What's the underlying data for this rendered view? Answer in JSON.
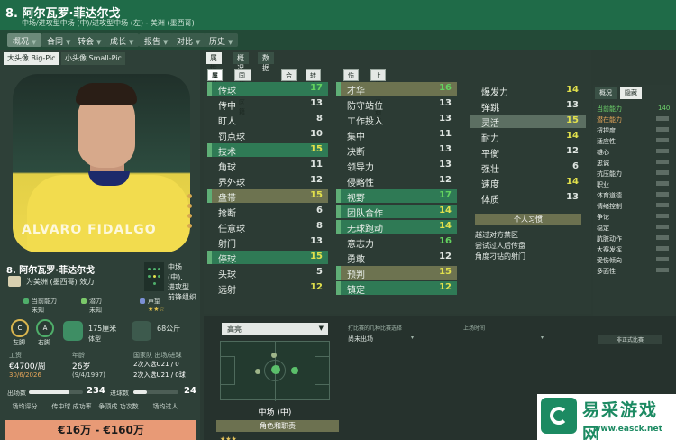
{
  "header": {
    "title": "8. 阿尔瓦罗·菲达尔戈",
    "subtitle": "中场/进攻型中场 (中)/进攻型中场 (左) - 美洲 (墨西哥)"
  },
  "nav_tabs": [
    "概况",
    "合同",
    "转会",
    "成长",
    "报告",
    "对比",
    "历史"
  ],
  "photo_tabs": [
    "大头像 Big-Pic",
    "小头像 Small-Pic"
  ],
  "photo": {
    "watermark": "ALVARO FIDALGO"
  },
  "player": {
    "name": "8. 阿尔瓦罗·菲达尔戈",
    "club_line": "为美洲 (墨西哥) 效力",
    "position_line1": "中场 (中),",
    "position_line2": "进攻型...",
    "position_line3": "前锋组织"
  },
  "info": {
    "current_ability_label": "当前能力",
    "current_ability_value": "未知",
    "potential_label": "潜力",
    "potential_value": "未知",
    "reputation_label": "声望",
    "foot_left_label": "左脚",
    "foot_right_label": "右脚",
    "foot_left_value": "C",
    "foot_right_value": "A",
    "height": "175厘米",
    "height_sub": "体型",
    "weight": "68公斤"
  },
  "contract": {
    "wage_label": "工资",
    "wage_value": "€4700/周",
    "wage_date": "30/6/2026",
    "age_label": "年龄",
    "age_value": "26岁",
    "age_date": "(9/4/1997)",
    "caps_label": "国家队 出场/进球",
    "caps_value": "2次入选U21 / 0",
    "caps_sub": "2次入选U21 / 0球"
  },
  "bars": {
    "left_label": "出场数",
    "left_value": "234",
    "left_fraction": 0.75,
    "right_label": "进球数",
    "right_value": "24",
    "right_fraction": 0.3
  },
  "bottom_headers": [
    "场均评分",
    "传中球 成功率",
    "争顶成 功次数",
    "场均过人"
  ],
  "value_range": "€16万 - €160万",
  "mid_tabs": [
    "属性",
    "概况",
    "数据"
  ],
  "attr_tabs": [
    "属性",
    "国籍/地区籍",
    "合同",
    "转会状态",
    "伤病",
    "上场时间通道"
  ],
  "technical": [
    {
      "name": "传球",
      "value": "17",
      "color": "green",
      "hl": "green"
    },
    {
      "name": "传中",
      "value": "13",
      "color": "white",
      "hl": ""
    },
    {
      "name": "盯人",
      "value": "8",
      "color": "white",
      "hl": ""
    },
    {
      "name": "罚点球",
      "value": "10",
      "color": "white",
      "hl": ""
    },
    {
      "name": "技术",
      "value": "15",
      "color": "yellow",
      "hl": "green"
    },
    {
      "name": "角球",
      "value": "11",
      "color": "white",
      "hl": ""
    },
    {
      "name": "界外球",
      "value": "12",
      "color": "white",
      "hl": ""
    },
    {
      "name": "盘带",
      "value": "15",
      "color": "yellow",
      "hl": "olive"
    },
    {
      "name": "抢断",
      "value": "6",
      "color": "white",
      "hl": ""
    },
    {
      "name": "任意球",
      "value": "8",
      "color": "white",
      "hl": ""
    },
    {
      "name": "射门",
      "value": "13",
      "color": "white",
      "hl": ""
    },
    {
      "name": "停球",
      "value": "15",
      "color": "yellow",
      "hl": "green"
    },
    {
      "name": "头球",
      "value": "5",
      "color": "white",
      "hl": ""
    },
    {
      "name": "远射",
      "value": "12",
      "color": "yellow",
      "hl": ""
    }
  ],
  "mental": [
    {
      "name": "才华",
      "value": "16",
      "color": "green",
      "hl": "olive"
    },
    {
      "name": "防守站位",
      "value": "13",
      "color": "white",
      "hl": ""
    },
    {
      "name": "工作投入",
      "value": "13",
      "color": "white",
      "hl": ""
    },
    {
      "name": "集中",
      "value": "11",
      "color": "white",
      "hl": ""
    },
    {
      "name": "决断",
      "value": "13",
      "color": "white",
      "hl": ""
    },
    {
      "name": "领导力",
      "value": "13",
      "color": "white",
      "hl": ""
    },
    {
      "name": "侵略性",
      "value": "12",
      "color": "white",
      "hl": ""
    },
    {
      "name": "视野",
      "value": "17",
      "color": "green",
      "hl": "green"
    },
    {
      "name": "团队合作",
      "value": "14",
      "color": "yellow",
      "hl": "green"
    },
    {
      "name": "无球跑动",
      "value": "14",
      "color": "yellow",
      "hl": "green"
    },
    {
      "name": "意志力",
      "value": "16",
      "color": "green",
      "hl": ""
    },
    {
      "name": "勇敢",
      "value": "12",
      "color": "white",
      "hl": ""
    },
    {
      "name": "预判",
      "value": "15",
      "color": "yellow",
      "hl": "olive"
    },
    {
      "name": "镇定",
      "value": "12",
      "color": "yellow",
      "hl": "green"
    }
  ],
  "physical": [
    {
      "name": "爆发力",
      "value": "14",
      "color": "yellow",
      "hl": ""
    },
    {
      "name": "弹跳",
      "value": "13",
      "color": "white",
      "hl": ""
    },
    {
      "name": "灵活",
      "value": "15",
      "color": "yellow",
      "hl": "mid"
    },
    {
      "name": "耐力",
      "value": "14",
      "color": "yellow",
      "hl": ""
    },
    {
      "name": "平衡",
      "value": "12",
      "color": "white",
      "hl": ""
    },
    {
      "name": "强壮",
      "value": "6",
      "color": "white",
      "hl": ""
    },
    {
      "name": "速度",
      "value": "14",
      "color": "yellow",
      "hl": ""
    },
    {
      "name": "体质",
      "value": "13",
      "color": "white",
      "hl": ""
    }
  ],
  "traits": {
    "title": "个人习惯",
    "items": [
      "越过对方禁区",
      "尝试过人后传盘",
      "角度刁钻的射门"
    ]
  },
  "right_tabs": [
    "概况",
    "隐藏"
  ],
  "hidden": [
    {
      "name": "当前能力",
      "value": "140",
      "color": "#6ed36b"
    },
    {
      "name": "潜在能力",
      "value": "",
      "color": "#e7a65a"
    },
    {
      "name": "扭捏度",
      "value": "",
      "color": "#e6ece8"
    },
    {
      "name": "适应性",
      "value": "",
      "color": "#e6ece8"
    },
    {
      "name": "雄心",
      "value": "",
      "color": "#e6ece8"
    },
    {
      "name": "忠诚",
      "value": "",
      "color": "#e6ece8"
    },
    {
      "name": "抗压能力",
      "value": "",
      "color": "#e6ece8"
    },
    {
      "name": "职业",
      "value": "",
      "color": "#e6ece8"
    },
    {
      "name": "体育道德",
      "value": "",
      "color": "#e6ece8"
    },
    {
      "name": "情绪控制",
      "value": "",
      "color": "#e6ece8"
    },
    {
      "name": "争论",
      "value": "",
      "color": "#e6ece8"
    },
    {
      "name": "稳定",
      "value": "",
      "color": "#e6ece8"
    },
    {
      "name": "肮脏动作",
      "value": "",
      "color": "#e6ece8"
    },
    {
      "name": "大赛发挥",
      "value": "",
      "color": "#e6ece8"
    },
    {
      "name": "受伤倾向",
      "value": "",
      "color": "#e6ece8"
    },
    {
      "name": "多面性",
      "value": "",
      "color": "#e6ece8"
    }
  ],
  "pitch_panel": {
    "select_value": "高亮",
    "role": "中场 (中)",
    "role_button": "角色和职责",
    "duty": "★★★"
  },
  "history": {
    "header1": "打比赛的几种比赛选择",
    "row1": "尚未出场",
    "header2": "上场时间",
    "right_cell": "非正式比赛"
  }
}
